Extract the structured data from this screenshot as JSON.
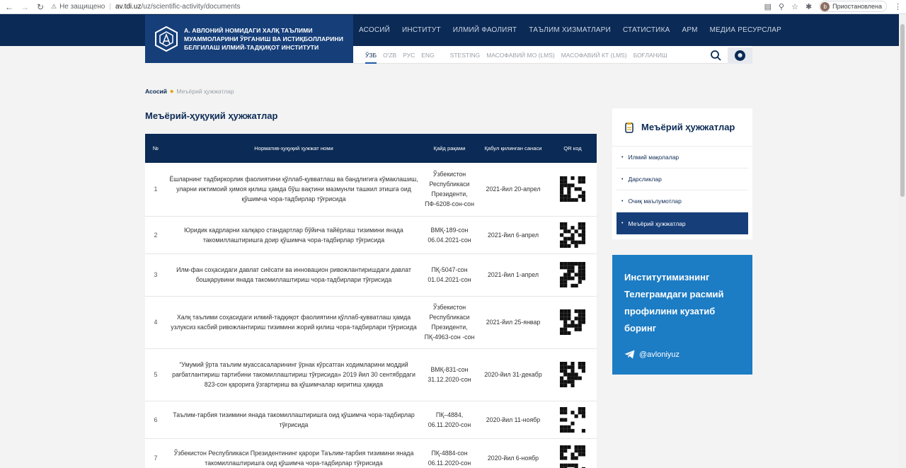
{
  "browser": {
    "insecure_label": "Не защищено",
    "url_host": "av.tdi.uz",
    "url_path": "/uz/scientific-activity/documents",
    "profile_initial": "b",
    "profile_status": "Приостановлена"
  },
  "header": {
    "logo_lines": [
      "А. АВЛОНИЙ НОМИДАГИ ХАЛҚ ТАЪЛИМИ",
      "МУАММОЛАРИНИ ЎРГАНИШ ВА ИСТИҚБОЛЛАРИНИ",
      "БЕЛГИЛАШ ИЛМИЙ-ТАДҚИҚОТ ИНСТИТУТИ"
    ],
    "main_nav": [
      "АСОСИЙ",
      "ИНСТИТУТ",
      "ИЛМИЙ ФАОЛИЯТ",
      "ТАЪЛИМ ХИЗМАТЛАРИ",
      "СТАТИСТИКА",
      "АРМ",
      "МЕДИА РЕСУРСЛАР"
    ],
    "languages": [
      "ЎЗБ",
      "O'ZB",
      "РУС",
      "ENG"
    ],
    "sub_nav": [
      "STESTING",
      "МАСОФАВИЙ МО (LMS)",
      "МАСОФАВИЙ КТ (LMS)",
      "БОҒЛАНИШ"
    ]
  },
  "breadcrumb": {
    "home": "Асосий",
    "current": "Меъёрий ҳужжатлар"
  },
  "page_title": "Меъёрий-ҳуқуқий ҳужжатлар",
  "table": {
    "headers": [
      "№",
      "Норматив-ҳуқуқий ҳужжат номи",
      "Қайд рақами",
      "Қабул қилинган санаси",
      "QR код"
    ],
    "rows": [
      {
        "num": "1",
        "name": "Ёшларнинг тадбиркорлик фаолиятини қўллаб-қувватлаш ва бандлигига кўмаклашиш, уларни ижтимоий ҳимоя қилиш ҳамда бўш вақтини мазмунли ташкил этишга оид қўшимча чора-тадбирлар тўғрисида",
        "reg": "Ўзбекистон Республикаси Президенти, ПФ-6208-сон-сон",
        "date": "2021-йил 20-апрел"
      },
      {
        "num": "2",
        "name": "Юридик кадрларни халқаро стандартлар бўйича тайёрлаш тизимини янада такомиллаштиришга доир қўшимча чора-тадбирлар тўғрисида",
        "reg": "ВМҚ-189-сон 06.04.2021-сон",
        "date": "2021-йил 6-апрел"
      },
      {
        "num": "3",
        "name": "Илм-фан соҳасидаги давлат сиёсати ва инновацион ривожлантиришдаги давлат бошқарувини янада такомиллаштириш чора-тадбирлари тўғрисида",
        "reg": "ПҚ-5047-сон 01.04.2021-сон",
        "date": "2021-йил 1-апрел"
      },
      {
        "num": "4",
        "name": "Халқ таълими соҳасидаги илмий-тадқиқот фаолиятини қўллаб-қувватлаш ҳамда узлуксиз касбий ривожлантириш тизимини жорий қилиш чора-тадбирлари тўғрисида",
        "reg": "Ўзбекистон Республикаси Президенти, ПҚ-4963-сон -сон",
        "date": "2021-йил 25-январ"
      },
      {
        "num": "5",
        "name": "“Умумий ўрта таълим муассасаларининг ўрнак кўрсатган ходимларини моддий рағбатлантириш тартибини такомиллаштириш тўғрисида» 2019 йил 30 сентябрдаги 823-сон қарорига ўзгартириш ва қўшимчалар киритиш ҳақида",
        "reg": "ВМҚ-831-сон 31.12.2020-сон",
        "date": "2020-йил 31-декабр"
      },
      {
        "num": "6",
        "name": "Таълим-тарбия тизимини янада такомиллаштиришга оид қўшимча чора-тадбирлар тўғрисида",
        "reg": "ПҚ–4884, 06.11.2020-сон",
        "date": "2020-йил 11-ноябр"
      },
      {
        "num": "7",
        "name": "Ўзбекистон Республикаси Президентининг қарори Таълим-тарбия тизимини янада такомиллаштиришга оид қўшимча чора-тадбирлар тўғрисида",
        "reg": "ПҚ-4884-сон 06.11.2020-сон",
        "date": "2020-йил 6-ноябр"
      }
    ]
  },
  "sidebar": {
    "title": "Меъёрий ҳужжатлар",
    "items": [
      {
        "label": "Илмий мақолалар"
      },
      {
        "label": "Дарсликлар"
      },
      {
        "label": "Очиқ маълумотлар"
      },
      {
        "label": "Меъёрий ҳужжатлар",
        "active": true
      }
    ]
  },
  "telegram": {
    "text": "Институтимизнинг Телеграмдаги расмий профилини кузатиб боринг",
    "handle": "@avloniyuz"
  },
  "colors": {
    "navy": "#0b2a55",
    "logo_bg": "#163f7a",
    "telegram_blue": "#1c7cc4",
    "accent_dot": "#e0a800"
  }
}
